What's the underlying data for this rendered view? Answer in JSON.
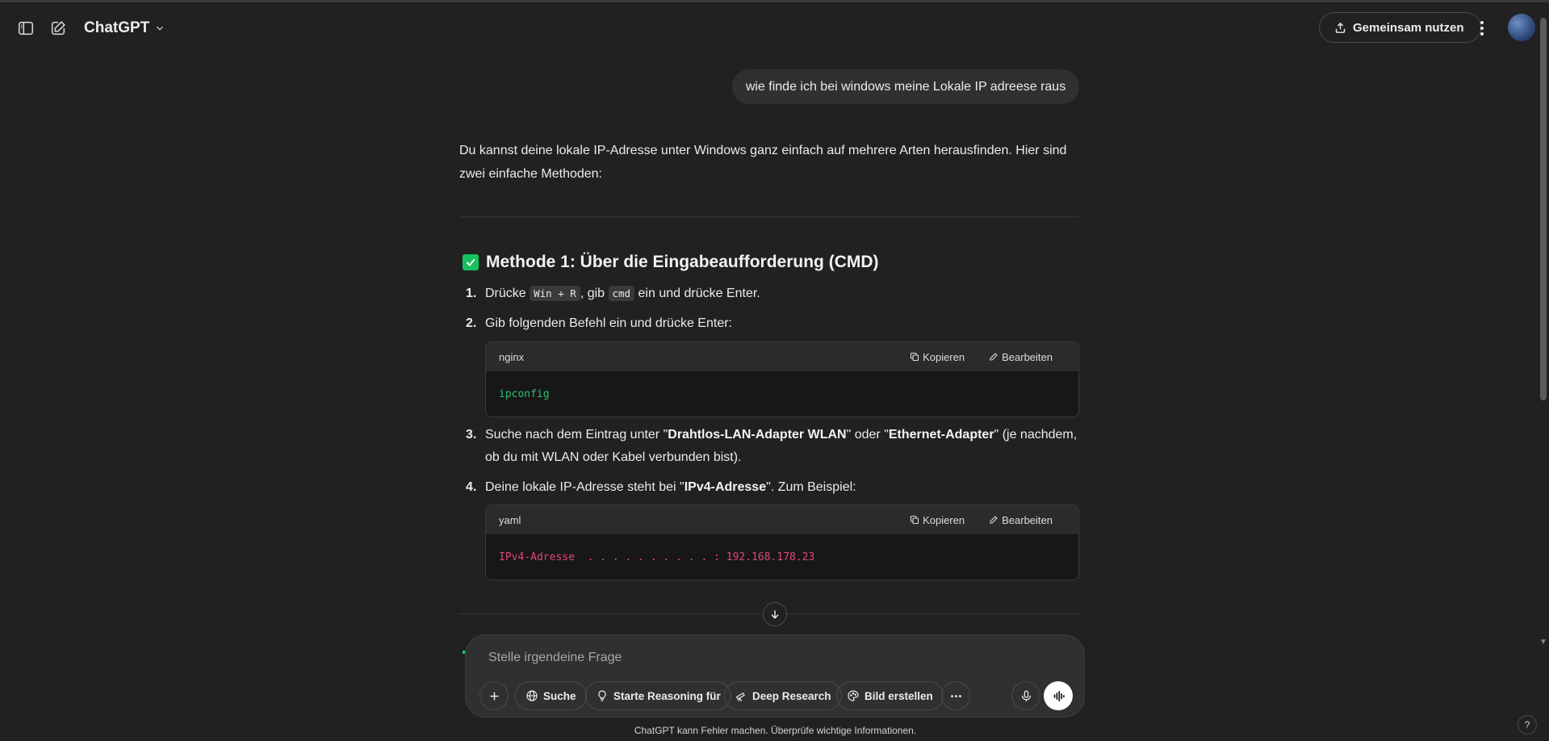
{
  "header": {
    "model_name": "ChatGPT",
    "share_label": "Gemeinsam nutzen"
  },
  "conversation": {
    "user_message": "wie finde ich bei windows meine Lokale IP adreese raus",
    "intro": "Du kannst deine lokale IP-Adresse unter Windows ganz einfach auf mehrere Arten herausfinden. Hier sind zwei einfache Methoden:",
    "method1_title": "Methode 1: Über die Eingabeaufforderung (CMD)",
    "steps": [
      {
        "num": "1.",
        "pre": "Drücke ",
        "code1": "Win + R",
        "mid": ", gib ",
        "code2": "cmd",
        "post": " ein und drücke Enter."
      },
      {
        "num": "2.",
        "text": "Gib folgenden Befehl ein und drücke Enter:"
      },
      {
        "num": "3.",
        "pre": "Suche nach dem Eintrag unter \"",
        "bold1": "Drahtlos-LAN-Adapter WLAN",
        "mid": "\" oder \"",
        "bold2": "Ethernet-Adapter",
        "post": "\" (je nachdem, ob du mit WLAN oder Kabel verbunden bist)."
      },
      {
        "num": "4.",
        "pre": "Deine lokale IP-Adresse steht bei \"",
        "bold1": "IPv4-Adresse",
        "post": "\". Zum Beispiel:"
      }
    ],
    "code_blocks": [
      {
        "lang": "nginx",
        "code": "ipconfig",
        "copy_label": "Kopieren",
        "edit_label": "Bearbeiten"
      },
      {
        "lang": "yaml",
        "code": "IPv4-Adresse  . . . . . . . . . . : 192.168.178.23",
        "copy_label": "Kopieren",
        "edit_label": "Bearbeiten"
      }
    ]
  },
  "composer": {
    "placeholder": "Stelle irgendeine Frage",
    "tools": {
      "search": "Suche",
      "reasoning": "Starte Reasoning für",
      "deep_research": "Deep Research",
      "image": "Bild erstellen"
    }
  },
  "footer": {
    "disclaimer": "ChatGPT kann Fehler machen. Überprüfe wichtige Informationen.",
    "help": "?"
  },
  "colors": {
    "background": "#212121",
    "accent_green": "#16c25e",
    "code_green": "#2fbf71",
    "code_pink": "#e2457a"
  }
}
